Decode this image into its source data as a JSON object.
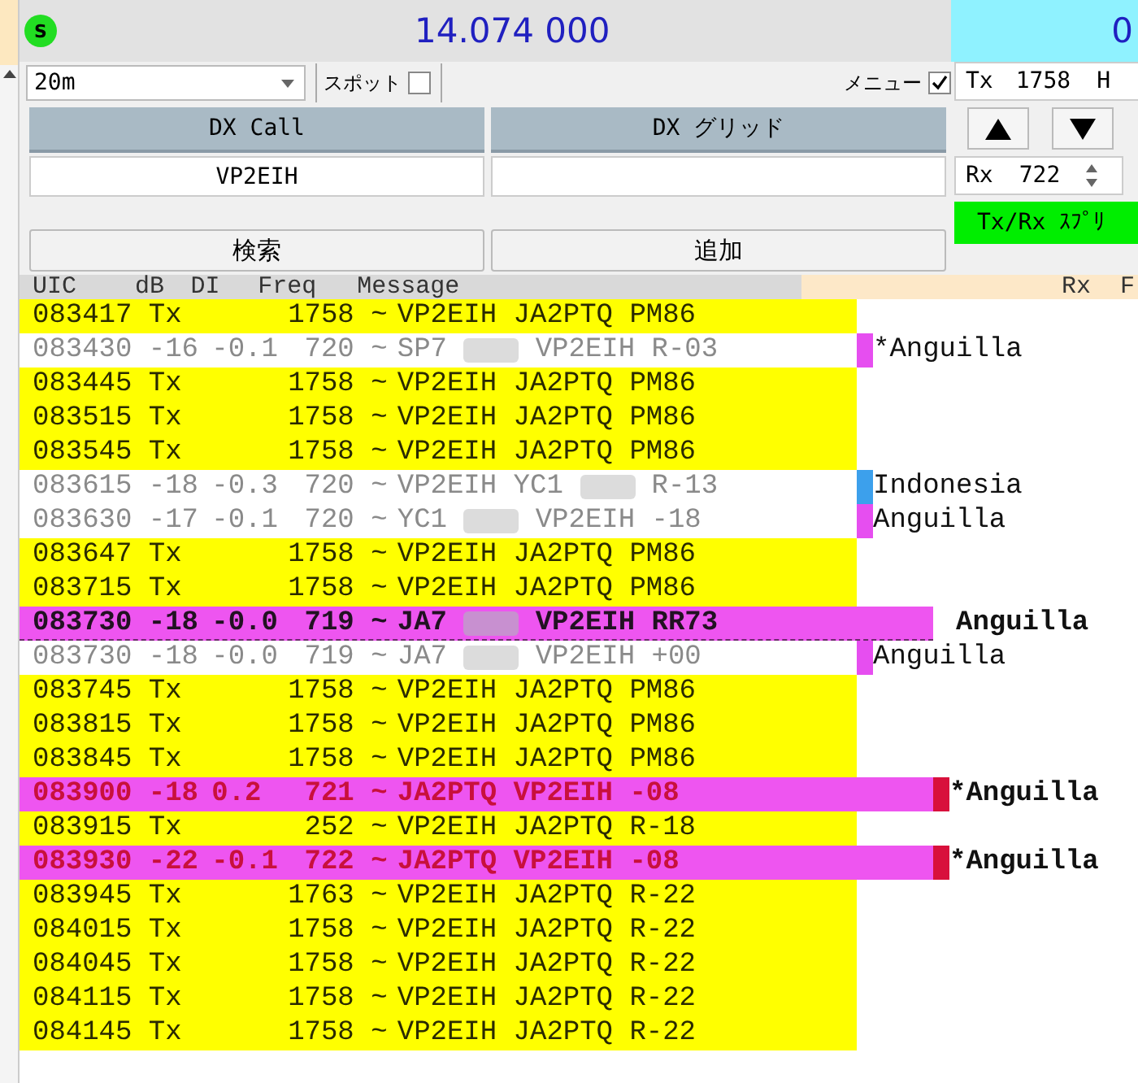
{
  "status_icon": {
    "label": "S"
  },
  "frequency": "14.074 000",
  "right_display": {
    "text": "0"
  },
  "band": {
    "value": "20m"
  },
  "spot": {
    "label": "スポット",
    "checked": false
  },
  "menu": {
    "label": "メニュー",
    "checked": true
  },
  "tx_field": {
    "label": "Tx",
    "value": "1758",
    "unit": "H"
  },
  "rx_field": {
    "label": "Rx",
    "value": "722"
  },
  "split_button": {
    "label": "Tx/Rx ｽﾌﾟﾘ"
  },
  "dx_call": {
    "label": "DX Call",
    "value": "VP2EIH"
  },
  "dx_grid": {
    "label": "DX グリッド"
  },
  "buttons": [
    "検索",
    "追加"
  ],
  "table": {
    "columns": [
      "UIC",
      "dB",
      "DI",
      "Freq",
      "Message"
    ],
    "right_header": "Rx  F",
    "rows": [
      {
        "kind": "tx",
        "utc": "083417",
        "db": "Tx",
        "dt": "",
        "freq": "1758",
        "mode": "~",
        "message": "VP2EIH JA2PTQ PM86"
      },
      {
        "kind": "decode",
        "utc": "083430",
        "db": "-16",
        "dt": "-0.1",
        "freq": "720",
        "mode": "~",
        "message": "SP7",
        "redacted": true,
        "message_tail": "VP2EIH R-03",
        "country": "*Anguilla",
        "color": "#e64ef0"
      },
      {
        "kind": "tx",
        "utc": "083445",
        "db": "Tx",
        "dt": "",
        "freq": "1758",
        "mode": "~",
        "message": "VP2EIH JA2PTQ PM86"
      },
      {
        "kind": "tx",
        "utc": "083515",
        "db": "Tx",
        "dt": "",
        "freq": "1758",
        "mode": "~",
        "message": "VP2EIH JA2PTQ PM86"
      },
      {
        "kind": "tx",
        "utc": "083545",
        "db": "Tx",
        "dt": "",
        "freq": "1758",
        "mode": "~",
        "message": "VP2EIH JA2PTQ PM86"
      },
      {
        "kind": "decode",
        "utc": "083615",
        "db": "-18",
        "dt": "-0.3",
        "freq": "720",
        "mode": "~",
        "message": "VP2EIH YC1",
        "redacted": true,
        "message_tail": "R-13",
        "country": "Indonesia",
        "color": "#3ca0ec"
      },
      {
        "kind": "decode",
        "utc": "083630",
        "db": "-17",
        "dt": "-0.1",
        "freq": "720",
        "mode": "~",
        "message": "YC1",
        "redacted": true,
        "message_tail": "VP2EIH -18",
        "country": "Anguilla",
        "color": "#e64ef0"
      },
      {
        "kind": "tx",
        "utc": "083647",
        "db": "Tx",
        "dt": "",
        "freq": "1758",
        "mode": "~",
        "message": "VP2EIH JA2PTQ PM86"
      },
      {
        "kind": "tx",
        "utc": "083715",
        "db": "Tx",
        "dt": "",
        "freq": "1758",
        "mode": "~",
        "message": "VP2EIH JA2PTQ PM86"
      },
      {
        "kind": "highlight",
        "utc": "083730",
        "db": "-18",
        "dt": "-0.0",
        "freq": "719",
        "mode": "~",
        "message": "JA7",
        "redacted": true,
        "message_tail": "VP2EIH RR73",
        "country": "Anguilla"
      },
      {
        "kind": "decode",
        "utc": "083730",
        "db": "-18",
        "dt": "-0.0",
        "freq": "719",
        "mode": "~",
        "message": "JA7",
        "redacted": true,
        "message_tail": "VP2EIH +00",
        "country": "Anguilla",
        "color": "#e64ef0"
      },
      {
        "kind": "tx",
        "utc": "083745",
        "db": "Tx",
        "dt": "",
        "freq": "1758",
        "mode": "~",
        "message": "VP2EIH JA2PTQ PM86"
      },
      {
        "kind": "tx",
        "utc": "083815",
        "db": "Tx",
        "dt": "",
        "freq": "1758",
        "mode": "~",
        "message": "VP2EIH JA2PTQ PM86"
      },
      {
        "kind": "tx",
        "utc": "083845",
        "db": "Tx",
        "dt": "",
        "freq": "1758",
        "mode": "~",
        "message": "VP2EIH JA2PTQ PM86"
      },
      {
        "kind": "to-me",
        "utc": "083900",
        "db": "-18",
        "dt": "0.2",
        "freq": "721",
        "mode": "~",
        "message": "JA2PTQ VP2EIH -08",
        "country": "*Anguilla",
        "color": "#d8103c"
      },
      {
        "kind": "tx",
        "utc": "083915",
        "db": "Tx",
        "dt": "",
        "freq": "252",
        "mode": "~",
        "message": "VP2EIH JA2PTQ R-18"
      },
      {
        "kind": "to-me",
        "utc": "083930",
        "db": "-22",
        "dt": "-0.1",
        "freq": "722",
        "mode": "~",
        "message": "JA2PTQ VP2EIH -08",
        "country": "*Anguilla",
        "color": "#d8103c"
      },
      {
        "kind": "tx",
        "utc": "083945",
        "db": "Tx",
        "dt": "",
        "freq": "1763",
        "mode": "~",
        "message": "VP2EIH JA2PTQ R-22"
      },
      {
        "kind": "tx",
        "utc": "084015",
        "db": "Tx",
        "dt": "",
        "freq": "1758",
        "mode": "~",
        "message": "VP2EIH JA2PTQ R-22"
      },
      {
        "kind": "tx",
        "utc": "084045",
        "db": "Tx",
        "dt": "",
        "freq": "1758",
        "mode": "~",
        "message": "VP2EIH JA2PTQ R-22"
      },
      {
        "kind": "tx",
        "utc": "084115",
        "db": "Tx",
        "dt": "",
        "freq": "1758",
        "mode": "~",
        "message": "VP2EIH JA2PTQ R-22"
      },
      {
        "kind": "tx",
        "utc": "084145",
        "db": "Tx",
        "dt": "",
        "freq": "1758",
        "mode": "~",
        "message": "VP2EIH JA2PTQ R-22"
      }
    ]
  }
}
